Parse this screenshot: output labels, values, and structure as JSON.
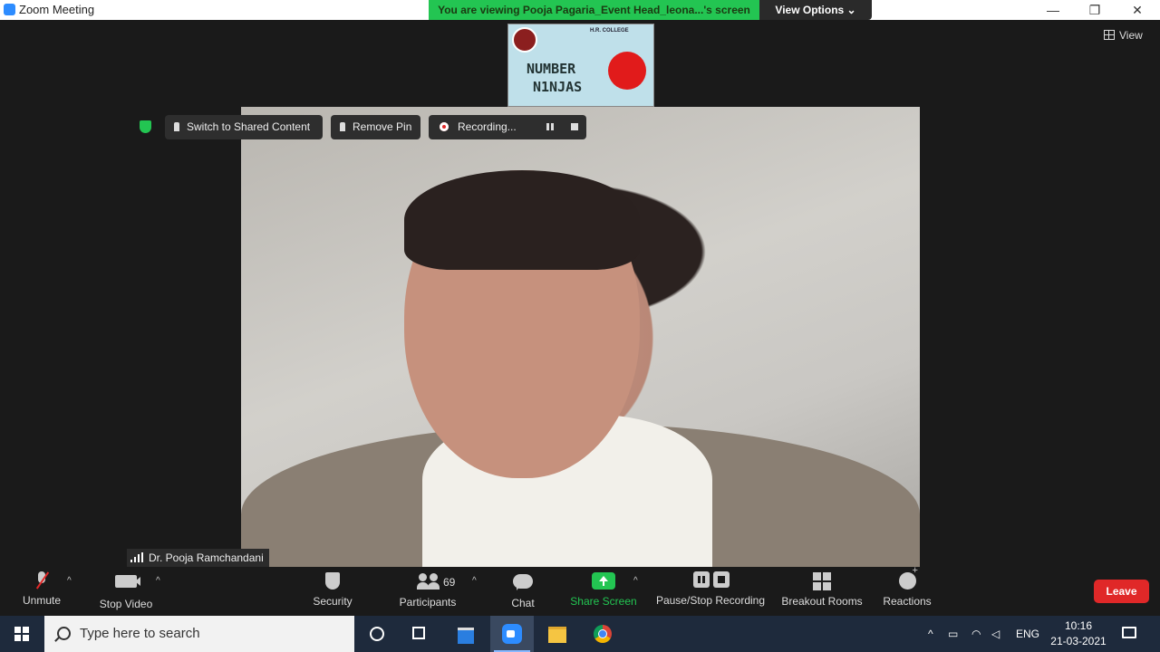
{
  "window": {
    "title": "Zoom Meeting",
    "minimize": "—",
    "restore": "❐",
    "close": "✕"
  },
  "share_banner": {
    "text": "You are viewing Pooja Pagaria_Event Head_leona...'s screen",
    "view_options": "View Options ⌄"
  },
  "view_button": "View",
  "thumbnail": {
    "line1": "NUMBER",
    "line2": "N1NJAS",
    "college": "H.R. COLLEGE"
  },
  "video_controls": {
    "switch_label": "Switch to Shared Content",
    "remove_pin_label": "Remove Pin",
    "recording_label": "Recording..."
  },
  "participant": {
    "name": "Dr. Pooja Ramchandani"
  },
  "toolbar": {
    "unmute": "Unmute",
    "stop_video": "Stop Video",
    "security": "Security",
    "participants": "Participants",
    "participants_count": "69",
    "chat": "Chat",
    "share_screen": "Share Screen",
    "pause_stop_recording": "Pause/Stop Recording",
    "breakout_rooms": "Breakout Rooms",
    "reactions": "Reactions",
    "leave": "Leave",
    "caret": "^"
  },
  "taskbar": {
    "search_placeholder": "Type here to search",
    "language": "ENG",
    "time": "10:16",
    "date": "21-03-2021"
  },
  "colors": {
    "accent_green": "#23c552",
    "leave_red": "#e02828",
    "zoom_blue": "#2d8cff"
  }
}
